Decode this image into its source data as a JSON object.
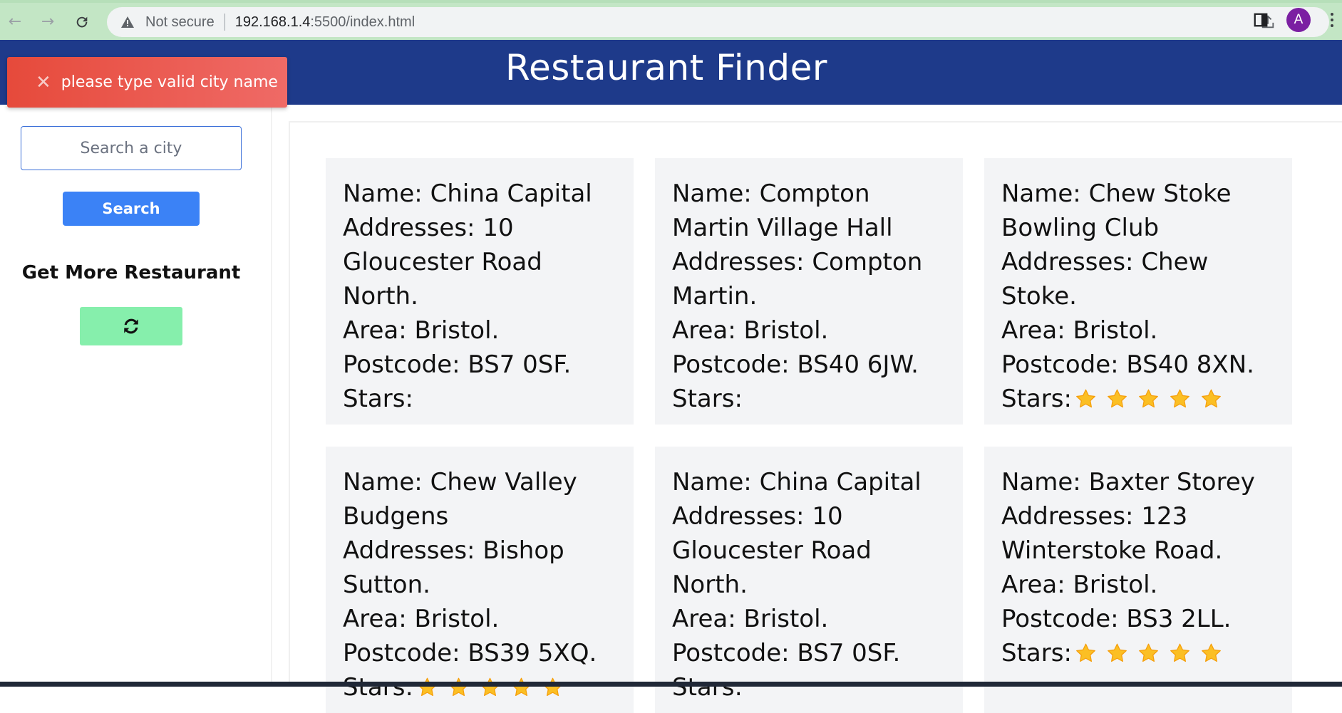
{
  "browser": {
    "not_secure": "Not secure",
    "url_host": "192.168.1.4",
    "url_rest": ":5500/index.html",
    "avatar_letter": "A"
  },
  "header": {
    "title": "Restaurant Finder"
  },
  "toast": {
    "message": "please type valid city name"
  },
  "sidebar": {
    "search_placeholder": "Search a city",
    "search_label": "Search",
    "more_title": "Get More Restaurant"
  },
  "colors": {
    "header": "#1e3a8a",
    "search_button": "#3b82f6",
    "refresh_button": "#86efac",
    "toast": "#e64a3b",
    "star": "#fbbf24"
  },
  "labels": {
    "name": "Name:",
    "addresses": "Addresses:",
    "area": "Area:",
    "postcode": "Postcode:",
    "stars": "Stars:"
  },
  "restaurants": [
    {
      "name": "China Capital",
      "address": "10 Gloucester Road North.",
      "area": "Bristol.",
      "postcode": "BS7 0SF.",
      "stars": 0
    },
    {
      "name": "Compton Martin Village Hall",
      "address": "Compton Martin.",
      "area": "Bristol.",
      "postcode": "BS40 6JW.",
      "stars": 0
    },
    {
      "name": "Chew Stoke Bowling Club",
      "address": "Chew Stoke.",
      "area": "Bristol.",
      "postcode": "BS40 8XN.",
      "stars": 5
    },
    {
      "name": "Chew Valley Budgens",
      "address": "Bishop Sutton.",
      "area": "Bristol.",
      "postcode": "BS39 5XQ.",
      "stars": 5
    },
    {
      "name": "China Capital",
      "address": "10 Gloucester Road North.",
      "area": "Bristol.",
      "postcode": "BS7 0SF.",
      "stars": 0
    },
    {
      "name": "Baxter Storey",
      "address": "123 Winterstoke Road.",
      "area": "Bristol.",
      "postcode": "BS3 2LL.",
      "stars": 5
    }
  ]
}
